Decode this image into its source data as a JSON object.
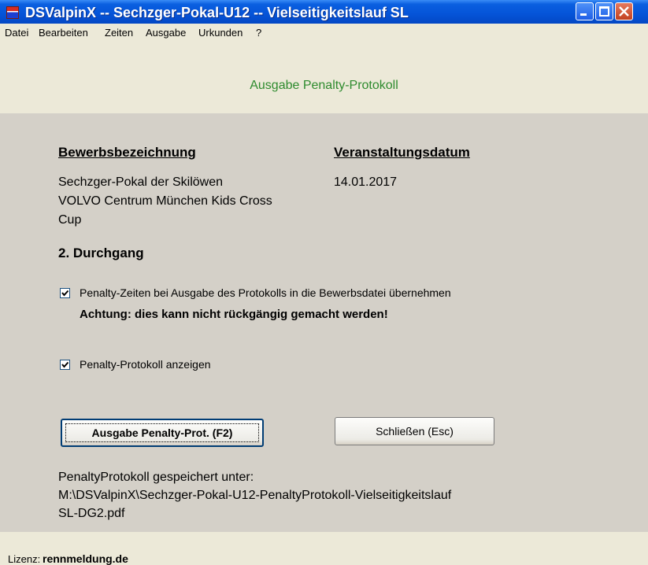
{
  "window": {
    "title": "DSValpinX -- Sechzger-Pokal-U12 -- Vielseitigkeitslauf SL",
    "icon": "app-logo-icon"
  },
  "menu": {
    "items": [
      "Datei",
      "Bearbeiten",
      "Zeiten",
      "Ausgabe",
      "Urkunden",
      "?"
    ]
  },
  "header": {
    "title": "Ausgabe Penalty-Protokoll",
    "title_color": "#2e8b2e"
  },
  "event": {
    "name_heading": "Bewerbsbezeichnung",
    "name_lines": [
      "Sechzger-Pokal der Skilöwen",
      "VOLVO Centrum München Kids Cross",
      "Cup"
    ],
    "date_heading": "Veranstaltungsdatum",
    "date": "14.01.2017",
    "run": "2. Durchgang"
  },
  "options": {
    "transfer_label": "Penalty-Zeiten bei Ausgabe des Protokolls in die Bewerbsdatei übernehmen",
    "transfer_checked": true,
    "warning": "Achtung: dies kann nicht rückgängig gemacht werden!",
    "show_label": "Penalty-Protokoll anzeigen",
    "show_checked": true
  },
  "buttons": {
    "output": "Ausgabe Penalty-Prot. (F2)",
    "close": "Schließen (Esc)"
  },
  "saved": {
    "line1": "PenaltyProtokoll gespeichert unter:",
    "line2": "M:\\DSValpinX\\Sechzger-Pokal-U12-PenaltyProtokoll-Vielseitigkeitslauf",
    "line3": "SL-DG2.pdf"
  },
  "footer": {
    "license_label": "Lizenz:",
    "license_value": "rennmeldung.de"
  }
}
